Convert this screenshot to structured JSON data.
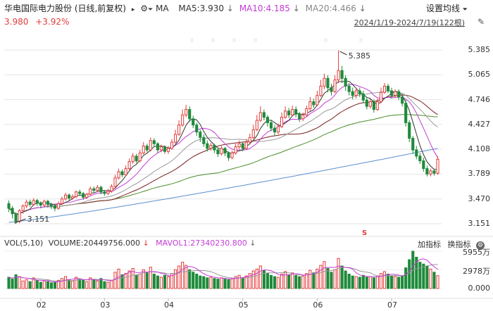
{
  "header": {
    "title": "华电国际电力股份 (日线,前复权)",
    "ma_label": "MA",
    "ma5": "MA5:3.930",
    "ma10": "MA10:4.185",
    "ma20": "MA20:4.466",
    "settings_label": "设置均线",
    "price": "3.980",
    "change": "+3.92%",
    "date_range": "2024/1/19-2024/7/19(122根)"
  },
  "colors": {
    "up": "#e33c3c",
    "down": "#1e8a3a",
    "ma5": "#333333",
    "ma10": "#c43bd6",
    "ma20": "#999999",
    "ma30": "#7a1f1f",
    "ma60": "#4a8c2a",
    "ma250": "#5b8fd1"
  },
  "main_axis": {
    "ticks": [
      "5.385",
      "5.065",
      "4.746",
      "4.427",
      "4.108",
      "3.789",
      "3.470",
      "3.151"
    ]
  },
  "annotations": {
    "high": "5.385",
    "low": "3.151"
  },
  "volume": {
    "header_label": "VOL(5,10)",
    "volume_value": "VOLUME:20449756.000",
    "mavol": "MAVOL1:27340230.800",
    "add_indicator": "加指标",
    "switch_indicator": "换指标",
    "ticks": [
      "5955万",
      "2978万",
      "0.000"
    ]
  },
  "x_axis": {
    "labels": [
      "02",
      "03",
      "04",
      "05",
      "06",
      "07"
    ]
  },
  "chart_data": {
    "type": "candlestick",
    "ylim": [
      3.151,
      5.385
    ],
    "ylabel": "",
    "candles": [
      [
        3.41,
        3.35,
        3.45,
        3.3
      ],
      [
        3.35,
        3.28,
        3.38,
        3.22
      ],
      [
        3.28,
        3.18,
        3.3,
        3.15
      ],
      [
        3.18,
        3.32,
        3.34,
        3.16
      ],
      [
        3.32,
        3.38,
        3.4,
        3.28
      ],
      [
        3.38,
        3.43,
        3.46,
        3.35
      ],
      [
        3.43,
        3.4,
        3.46,
        3.37
      ],
      [
        3.4,
        3.45,
        3.48,
        3.38
      ],
      [
        3.45,
        3.42,
        3.47,
        3.38
      ],
      [
        3.42,
        3.39,
        3.44,
        3.35
      ],
      [
        3.39,
        3.44,
        3.46,
        3.37
      ],
      [
        3.44,
        3.4,
        3.46,
        3.36
      ],
      [
        3.4,
        3.38,
        3.42,
        3.34
      ],
      [
        3.38,
        3.35,
        3.4,
        3.31
      ],
      [
        3.35,
        3.41,
        3.44,
        3.33
      ],
      [
        3.41,
        3.47,
        3.5,
        3.39
      ],
      [
        3.47,
        3.52,
        3.55,
        3.45
      ],
      [
        3.52,
        3.48,
        3.54,
        3.45
      ],
      [
        3.48,
        3.5,
        3.53,
        3.46
      ],
      [
        3.5,
        3.56,
        3.58,
        3.48
      ],
      [
        3.56,
        3.54,
        3.59,
        3.51
      ],
      [
        3.54,
        3.49,
        3.56,
        3.46
      ],
      [
        3.49,
        3.53,
        3.55,
        3.47
      ],
      [
        3.53,
        3.6,
        3.63,
        3.51
      ],
      [
        3.6,
        3.58,
        3.63,
        3.55
      ],
      [
        3.58,
        3.62,
        3.65,
        3.56
      ],
      [
        3.62,
        3.56,
        3.64,
        3.53
      ],
      [
        3.56,
        3.54,
        3.58,
        3.51
      ],
      [
        3.54,
        3.57,
        3.6,
        3.52
      ],
      [
        3.57,
        3.63,
        3.66,
        3.55
      ],
      [
        3.63,
        3.74,
        3.78,
        3.61
      ],
      [
        3.74,
        3.82,
        3.86,
        3.72
      ],
      [
        3.82,
        3.78,
        3.85,
        3.75
      ],
      [
        3.78,
        3.86,
        3.9,
        3.76
      ],
      [
        3.86,
        3.95,
        3.99,
        3.84
      ],
      [
        3.95,
        4.02,
        4.06,
        3.92
      ],
      [
        4.02,
        3.96,
        4.05,
        3.93
      ],
      [
        3.96,
        4.06,
        4.1,
        3.94
      ],
      [
        4.06,
        4.15,
        4.2,
        4.04
      ],
      [
        4.15,
        4.1,
        4.18,
        4.07
      ],
      [
        4.1,
        4.22,
        4.26,
        4.08
      ],
      [
        4.22,
        4.18,
        4.25,
        4.14
      ],
      [
        4.18,
        4.1,
        4.2,
        4.06
      ],
      [
        4.1,
        4.14,
        4.17,
        4.07
      ],
      [
        4.14,
        4.08,
        4.16,
        4.05
      ],
      [
        4.08,
        4.12,
        4.15,
        4.05
      ],
      [
        4.12,
        4.2,
        4.24,
        4.1
      ],
      [
        4.2,
        4.3,
        4.36,
        4.18
      ],
      [
        4.3,
        4.42,
        4.48,
        4.28
      ],
      [
        4.42,
        4.55,
        4.62,
        4.4
      ],
      [
        4.55,
        4.62,
        4.68,
        4.52
      ],
      [
        4.62,
        4.5,
        4.66,
        4.46
      ],
      [
        4.5,
        4.42,
        4.54,
        4.38
      ],
      [
        4.42,
        4.33,
        4.45,
        4.28
      ],
      [
        4.33,
        4.26,
        4.36,
        4.2
      ],
      [
        4.26,
        4.18,
        4.3,
        4.14
      ],
      [
        4.18,
        4.12,
        4.22,
        4.08
      ],
      [
        4.12,
        4.16,
        4.19,
        4.09
      ],
      [
        4.16,
        4.1,
        4.18,
        4.06
      ],
      [
        4.1,
        4.05,
        4.13,
        4.01
      ],
      [
        4.05,
        4.12,
        4.15,
        4.03
      ],
      [
        4.12,
        4.06,
        4.14,
        4.02
      ],
      [
        4.06,
        4.0,
        4.08,
        3.96
      ],
      [
        4.0,
        4.06,
        4.09,
        3.98
      ],
      [
        4.06,
        4.14,
        4.18,
        4.04
      ],
      [
        4.14,
        4.18,
        4.22,
        4.11
      ],
      [
        4.18,
        4.12,
        4.2,
        4.08
      ],
      [
        4.12,
        4.2,
        4.24,
        4.1
      ],
      [
        4.2,
        4.26,
        4.31,
        4.17
      ],
      [
        4.26,
        4.36,
        4.42,
        4.24
      ],
      [
        4.36,
        4.48,
        4.55,
        4.34
      ],
      [
        4.48,
        4.58,
        4.66,
        4.46
      ],
      [
        4.58,
        4.52,
        4.62,
        4.48
      ],
      [
        4.52,
        4.45,
        4.55,
        4.4
      ],
      [
        4.45,
        4.38,
        4.48,
        4.34
      ],
      [
        4.38,
        4.33,
        4.42,
        4.28
      ],
      [
        4.33,
        4.4,
        4.44,
        4.3
      ],
      [
        4.4,
        4.52,
        4.58,
        4.38
      ],
      [
        4.52,
        4.6,
        4.66,
        4.5
      ],
      [
        4.6,
        4.55,
        4.64,
        4.51
      ],
      [
        4.55,
        4.62,
        4.67,
        4.53
      ],
      [
        4.62,
        4.56,
        4.66,
        4.52
      ],
      [
        4.56,
        4.5,
        4.59,
        4.46
      ],
      [
        4.5,
        4.55,
        4.58,
        4.47
      ],
      [
        4.55,
        4.63,
        4.67,
        4.53
      ],
      [
        4.63,
        4.72,
        4.78,
        4.6
      ],
      [
        4.72,
        4.68,
        4.76,
        4.64
      ],
      [
        4.68,
        4.8,
        4.86,
        4.66
      ],
      [
        4.8,
        4.92,
        5.0,
        4.78
      ],
      [
        4.92,
        5.02,
        5.08,
        4.88
      ],
      [
        5.02,
        4.9,
        5.06,
        4.84
      ],
      [
        4.9,
        4.85,
        4.95,
        4.8
      ],
      [
        4.85,
        5.0,
        5.06,
        4.83
      ],
      [
        5.0,
        5.12,
        5.38,
        4.96
      ],
      [
        5.12,
        5.02,
        5.18,
        4.96
      ],
      [
        5.02,
        4.92,
        5.06,
        4.86
      ],
      [
        4.92,
        4.85,
        4.96,
        4.8
      ],
      [
        4.85,
        4.8,
        4.9,
        4.75
      ],
      [
        4.8,
        4.86,
        4.9,
        4.76
      ],
      [
        4.86,
        4.82,
        4.9,
        4.78
      ],
      [
        4.82,
        4.74,
        4.86,
        4.7
      ],
      [
        4.74,
        4.66,
        4.78,
        4.62
      ],
      [
        4.66,
        4.72,
        4.76,
        4.63
      ],
      [
        4.72,
        4.62,
        4.75,
        4.58
      ],
      [
        4.62,
        4.72,
        4.76,
        4.6
      ],
      [
        4.72,
        4.84,
        4.9,
        4.7
      ],
      [
        4.84,
        4.92,
        4.96,
        4.82
      ],
      [
        4.92,
        4.86,
        4.95,
        4.83
      ],
      [
        4.86,
        4.8,
        4.9,
        4.76
      ],
      [
        4.8,
        4.85,
        4.88,
        4.77
      ],
      [
        4.85,
        4.78,
        4.88,
        4.74
      ],
      [
        4.78,
        4.7,
        4.82,
        4.66
      ],
      [
        4.7,
        4.45,
        4.74,
        4.4
      ],
      [
        4.45,
        4.25,
        4.48,
        4.2
      ],
      [
        4.25,
        4.1,
        4.28,
        4.05
      ],
      [
        4.1,
        4.02,
        4.15,
        3.98
      ],
      [
        4.02,
        3.96,
        4.06,
        3.92
      ],
      [
        3.96,
        3.86,
        4.0,
        3.82
      ],
      [
        3.86,
        3.79,
        3.9,
        3.76
      ],
      [
        3.79,
        3.83,
        3.86,
        3.76
      ],
      [
        3.83,
        3.8,
        3.86,
        3.77
      ],
      [
        3.8,
        3.98,
        4.02,
        3.78
      ]
    ],
    "ma250_start": 3.17,
    "ma250_end": 4.12,
    "volume_max_wan": 5955,
    "volume_wan": [
      1800,
      1500,
      2200,
      1900,
      1200,
      1400,
      1100,
      1700,
      1300,
      1000,
      1200,
      1100,
      900,
      1000,
      1300,
      1600,
      1900,
      1400,
      1200,
      1800,
      1500,
      1300,
      1100,
      1700,
      1400,
      1200,
      1600,
      1100,
      1000,
      1300,
      2600,
      3100,
      2200,
      2400,
      2800,
      3200,
      2100,
      2300,
      3000,
      2500,
      3400,
      2300,
      2000,
      1800,
      2100,
      1900,
      2400,
      3000,
      3600,
      4200,
      3700,
      3000,
      2600,
      2300,
      2000,
      1900,
      1700,
      1800,
      1600,
      1500,
      1700,
      1500,
      1400,
      1600,
      1900,
      2100,
      1700,
      2000,
      2400,
      2800,
      3100,
      3600,
      2900,
      2400,
      2100,
      1900,
      1800,
      2300,
      2700,
      2200,
      2500,
      2100,
      1900,
      2000,
      2400,
      2900,
      2500,
      3100,
      3700,
      4300,
      3200,
      2600,
      3000,
      4800,
      3600,
      2800,
      2300,
      2000,
      1900,
      1800,
      2100,
      1800,
      1900,
      1700,
      1900,
      2400,
      2700,
      2300,
      2000,
      1900,
      1800,
      2000,
      3300,
      4600,
      5955,
      5000,
      4200,
      3900,
      3600,
      3100,
      2600,
      2045
    ]
  }
}
